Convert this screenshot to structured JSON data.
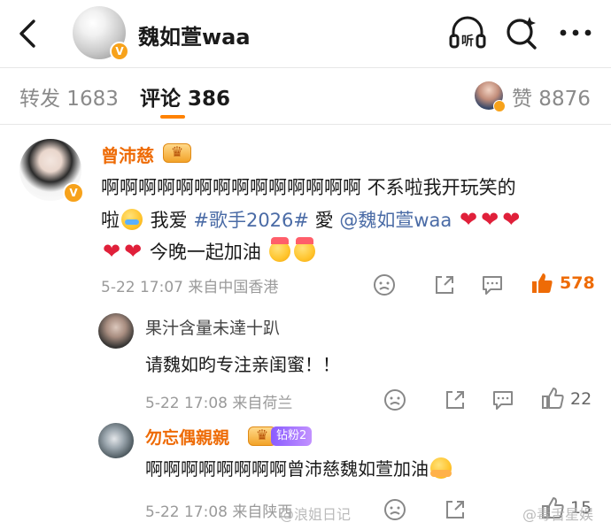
{
  "header": {
    "name": "魏如萱waa",
    "verified_badge": "V",
    "icons": [
      "back-icon",
      "listen-icon",
      "search-icon",
      "more-icon"
    ],
    "listen_label": "听"
  },
  "tabs": {
    "repost_label": "转发 1683",
    "comment_label": "评论 386",
    "likes_label": "赞 8876",
    "active_color": "#ff8200"
  },
  "comments": [
    {
      "username": "曾沛慈",
      "username_color": "#ee6b06",
      "text_line1": "啊啊啊啊啊啊啊啊啊啊啊啊啊啊 不系啦我开玩笑的",
      "text_line2_a": "啦",
      "text_line2_b": " 我爱 ",
      "topic": "#歌手2026#",
      "text_line2_c": " 愛 ",
      "mention": "@魏如萱waa",
      "text_line3": " 今晚一起加油",
      "hearts": "❤",
      "meta": "5-22 17:07  来自中国香港",
      "like_count": "578",
      "emojis": [
        "cry",
        "heart",
        "party"
      ]
    },
    {
      "username": "果汁含量未達十趴",
      "text": "请魏如昀专注亲闺蜜！！",
      "meta": "5-22 17:08  来自荷兰",
      "like_count": "22"
    },
    {
      "username": "勿忘偶親親",
      "fan_badge": "钻粉2",
      "text": "啊啊啊啊啊啊啊啊曾沛慈魏如萱加油",
      "meta": "5-22 17:08  来自陕西",
      "like_count": "15"
    }
  ],
  "watermarks": [
    "@浪姐日记",
    "@毒舌星娱"
  ],
  "colors": {
    "accent": "#ff8200",
    "link": "#4a6ba6",
    "muted": "#9a9a9a"
  }
}
